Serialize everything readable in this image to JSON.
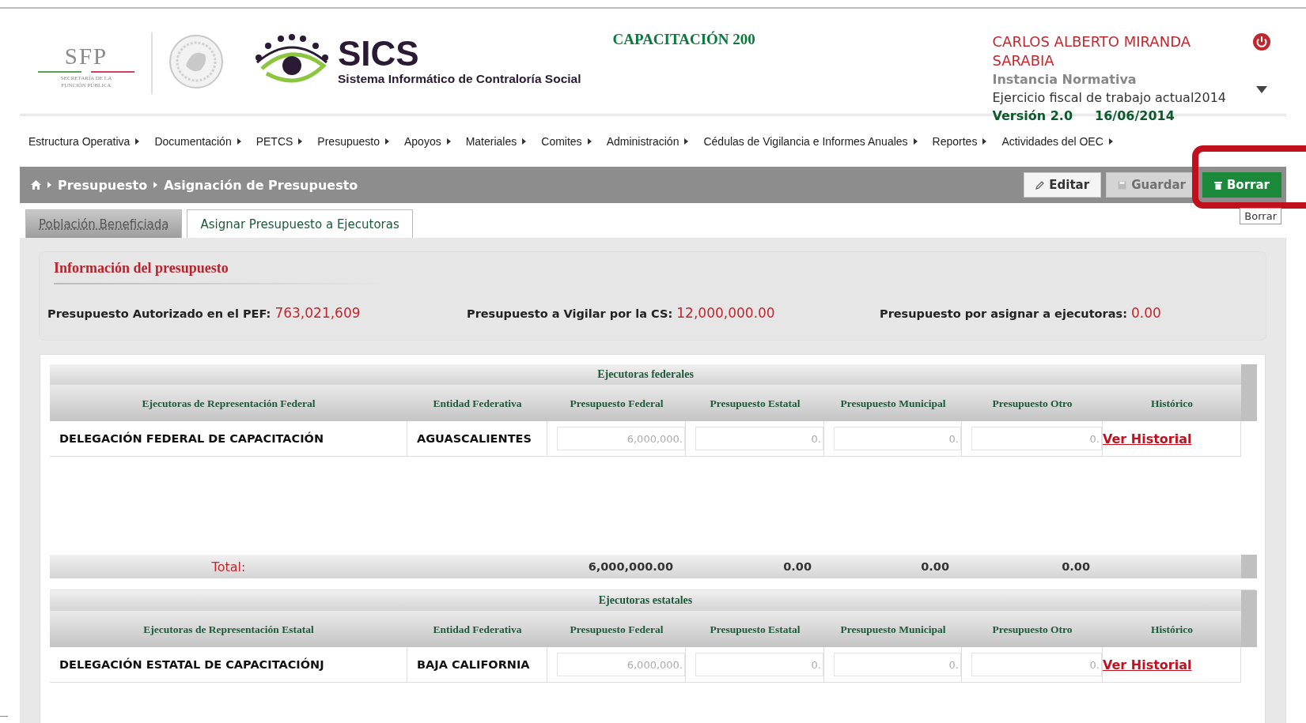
{
  "header": {
    "sfp_logo": {
      "letters": "SFP",
      "caption": "SECRETARÍA DE LA FUNCIÓN PÚBLICA"
    },
    "app_logo": {
      "name": "SICS",
      "subtitle": "Sistema Informático de Contraloría Social"
    },
    "program": "CAPACITACIÓN 200",
    "user": {
      "name": "CARLOS ALBERTO MIRANDA SARABIA",
      "role": "Instancia Normativa",
      "fiscal_year": "Ejercicio fiscal de trabajo actual2014",
      "version": "Versión 2.0",
      "date": "16/06/2014"
    }
  },
  "menu": [
    {
      "label": "Estructura Operativa"
    },
    {
      "label": "Documentación"
    },
    {
      "label": "PETCS"
    },
    {
      "label": "Presupuesto"
    },
    {
      "label": "Apoyos"
    },
    {
      "label": "Materiales"
    },
    {
      "label": "Comites"
    },
    {
      "label": "Administración"
    },
    {
      "label": "Cédulas de Vigilancia e Informes Anuales"
    },
    {
      "label": "Reportes"
    },
    {
      "label": "Actividades del OEC"
    }
  ],
  "breadcrumb": [
    "Presupuesto",
    "Asignación de Presupuesto"
  ],
  "actions": [
    {
      "label": "Editar",
      "kind": "edit",
      "disabled": false,
      "highlighted": false
    },
    {
      "label": "Guardar",
      "kind": "save",
      "disabled": true,
      "highlighted": false
    },
    {
      "label": "Borrar",
      "kind": "delete",
      "disabled": false,
      "highlighted": true
    }
  ],
  "tooltip": "Borrar",
  "tabs": [
    {
      "label": "Población Beneficiada",
      "selected": false
    },
    {
      "label": "Asignar Presupuesto a Ejecutoras",
      "selected": true
    }
  ],
  "info": {
    "title": "Información del presupuesto",
    "items": [
      {
        "label": "Presupuesto Autorizado en el PEF:",
        "value": "763,021,609"
      },
      {
        "label": "Presupuesto a Vigilar por la CS:",
        "value": "12,000,000.00"
      },
      {
        "label": "Presupuesto por asignar a ejecutoras:",
        "value": "0.00"
      }
    ]
  },
  "tables": [
    {
      "title": "Ejecutoras federales",
      "columns": [
        "Ejecutoras de Representación Federal",
        "Entidad Federativa",
        "Presupuesto Federal",
        "Presupuesto Estatal",
        "Presupuesto Municipal",
        "Presupuesto Otro",
        "Histórico"
      ],
      "rows": [
        {
          "name": "DELEGACIÓN FEDERAL DE CAPACITACIÓN",
          "entity": "AGUASCALIENTES",
          "inputs": [
            "6,000,000.",
            "0.",
            "0.",
            "0."
          ],
          "link": "Ver Historial"
        }
      ],
      "total": {
        "label": "Total:",
        "values": [
          "6,000,000.00",
          "0.00",
          "0.00",
          "0.00"
        ]
      }
    },
    {
      "title": "Ejecutoras estatales",
      "columns": [
        "Ejecutoras de Representación Estatal",
        "Entidad Federativa",
        "Presupuesto Federal",
        "Presupuesto Estatal",
        "Presupuesto Municipal",
        "Presupuesto Otro",
        "Histórico"
      ],
      "rows": [
        {
          "name": "DELEGACIÓN ESTATAL DE CAPACITACIÓNJ",
          "entity": "BAJA CALIFORNIA",
          "inputs": [
            "6,000,000.",
            "0.",
            "0.",
            "0."
          ],
          "link": "Ver Historial"
        }
      ]
    }
  ]
}
